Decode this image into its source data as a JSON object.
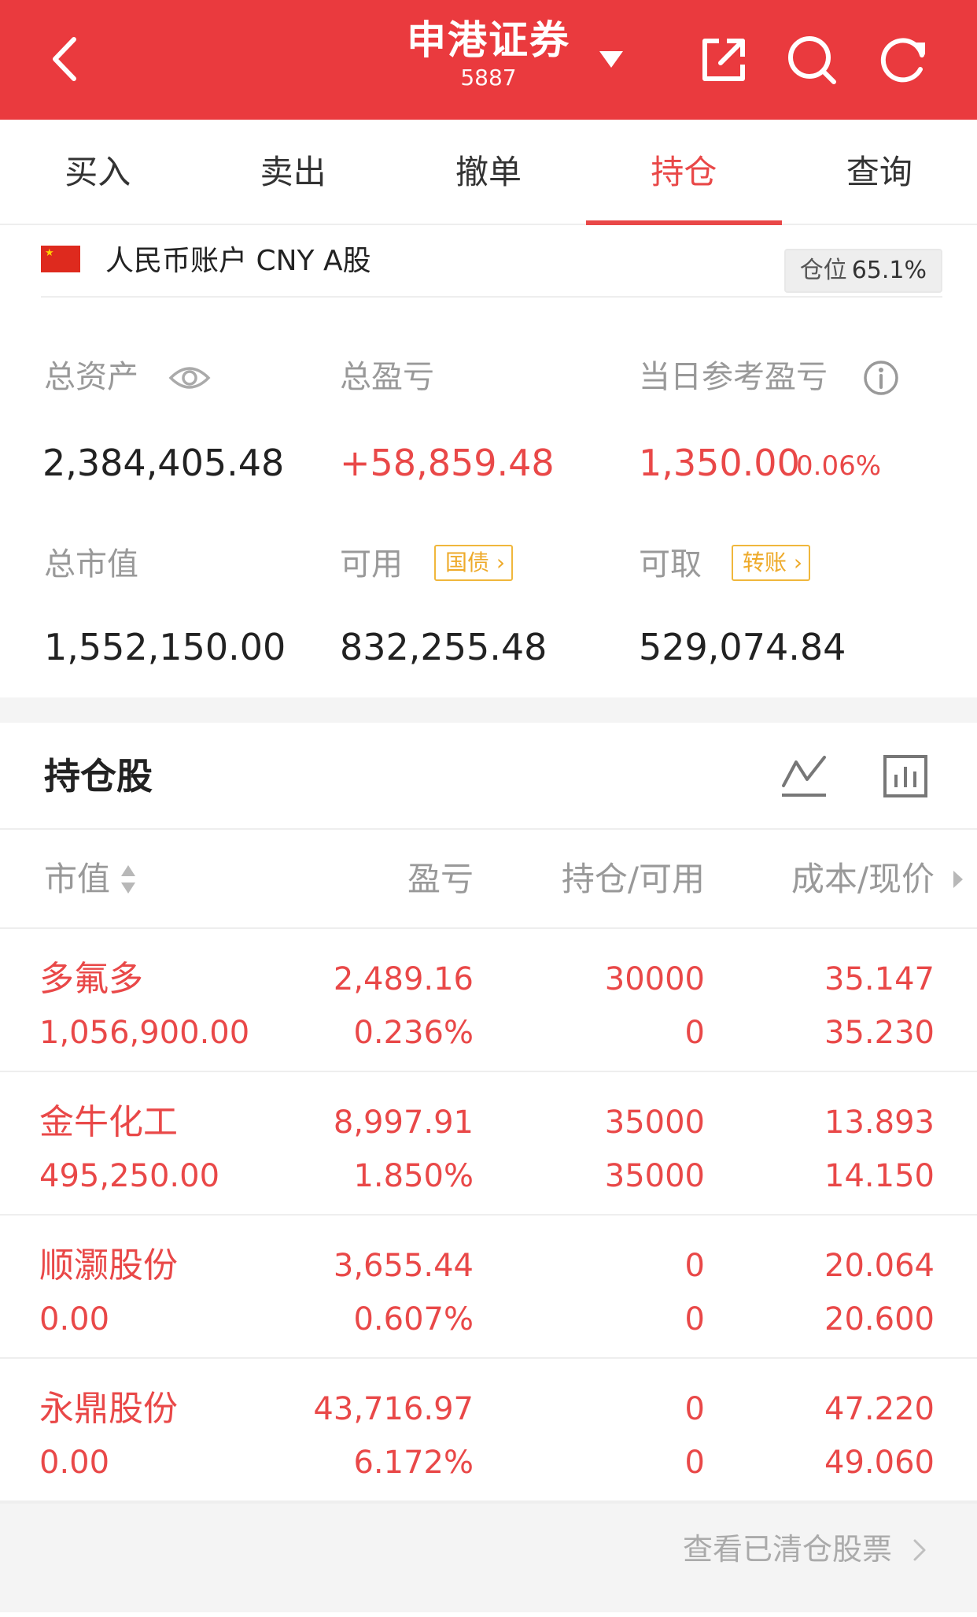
{
  "header": {
    "title": "申港证券",
    "account_id": "5887",
    "icons": [
      "back-arrow-icon",
      "caret-down-icon",
      "share-icon",
      "search-icon",
      "refresh-icon"
    ]
  },
  "tabs": [
    {
      "label": "买入",
      "active": false
    },
    {
      "label": "卖出",
      "active": false
    },
    {
      "label": "撤单",
      "active": false
    },
    {
      "label": "持仓",
      "active": true
    },
    {
      "label": "查询",
      "active": false
    }
  ],
  "account": {
    "name": "人民币账户 CNY A股",
    "position_label": "仓位",
    "position_value": "65.1%"
  },
  "summary": {
    "total_assets_label": "总资产",
    "total_assets": "2,384,405.48",
    "total_pl_label": "总盈亏",
    "total_pl": "+58,859.48",
    "daily_pl_label": "当日参考盈亏",
    "daily_pl": "1,350.00",
    "daily_pl_pct": "0.06%",
    "market_value_label": "总市值",
    "market_value": "1,552,150.00",
    "available_label": "可用",
    "available_tag": "国债",
    "available": "832,255.48",
    "withdrawable_label": "可取",
    "withdrawable_tag": "转账",
    "withdrawable": "529,074.84"
  },
  "holdings": {
    "title": "持仓股",
    "columns": {
      "market_value": "市值",
      "pl": "盈亏",
      "qty": "持仓/可用",
      "cost": "成本/现价"
    },
    "rows": [
      {
        "name": "多氟多",
        "market_value": "1,056,900.00",
        "pl": "2,489.16",
        "pl_pct": "0.236%",
        "qty": "30000",
        "available": "0",
        "cost": "35.147",
        "price": "35.230"
      },
      {
        "name": "金牛化工",
        "market_value": "495,250.00",
        "pl": "8,997.91",
        "pl_pct": "1.850%",
        "qty": "35000",
        "available": "35000",
        "cost": "13.893",
        "price": "14.150"
      },
      {
        "name": "顺灏股份",
        "market_value": "0.00",
        "pl": "3,655.44",
        "pl_pct": "0.607%",
        "qty": "0",
        "available": "0",
        "cost": "20.064",
        "price": "20.600"
      },
      {
        "name": "永鼎股份",
        "market_value": "0.00",
        "pl": "43,716.97",
        "pl_pct": "6.172%",
        "qty": "0",
        "available": "0",
        "cost": "47.220",
        "price": "49.060"
      }
    ]
  },
  "footer": {
    "cleared_link": "查看已清仓股票"
  },
  "colors": {
    "brand_red": "#ea3a3e",
    "profit_red": "#e94848",
    "tag_gold": "#eeaa2a",
    "label_gray": "#999999"
  }
}
